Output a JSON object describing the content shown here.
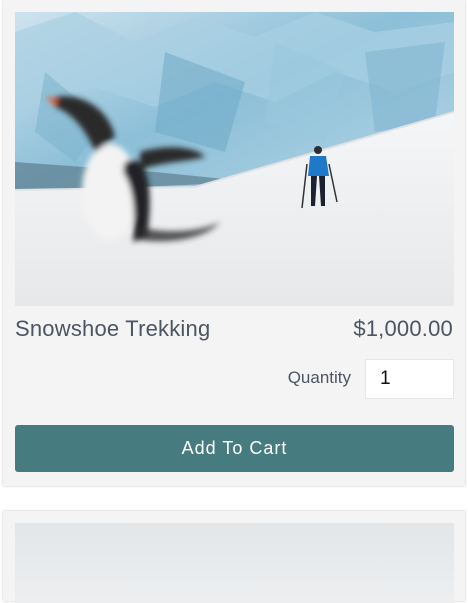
{
  "product": {
    "image_alt": "Hiker snowshoe trekking past a glacier with a penguin in the foreground",
    "name": "Snowshoe Trekking",
    "price": "$1,000.00",
    "quantity_label": "Quantity",
    "quantity_value": "1",
    "add_to_cart_label": "Add To Cart"
  },
  "colors": {
    "button": "#467b80",
    "text": "#4b5563",
    "card": "#f4f4f4"
  }
}
